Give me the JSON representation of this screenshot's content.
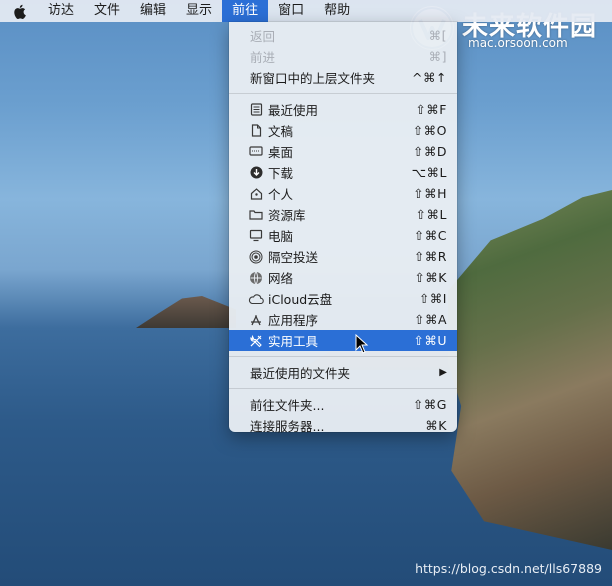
{
  "menubar": {
    "apple_icon": "apple-icon",
    "items": [
      {
        "label": "访达"
      },
      {
        "label": "文件"
      },
      {
        "label": "编辑"
      },
      {
        "label": "显示"
      },
      {
        "label": "前往"
      },
      {
        "label": "窗口"
      },
      {
        "label": "帮助"
      }
    ]
  },
  "brand": {
    "title": "未来软件园",
    "url": "mac.orsoon.com"
  },
  "dropdown": {
    "back": {
      "label": "返回",
      "shortcut": "⌘["
    },
    "forward": {
      "label": "前进",
      "shortcut": "⌘]"
    },
    "enclosing": {
      "label": "新窗口中的上层文件夹",
      "shortcut": "^⌘↑"
    },
    "places": [
      {
        "label": "最近使用",
        "shortcut": "⇧⌘F",
        "icon": "recents-icon"
      },
      {
        "label": "文稿",
        "shortcut": "⇧⌘O",
        "icon": "documents-icon"
      },
      {
        "label": "桌面",
        "shortcut": "⇧⌘D",
        "icon": "desktop-icon"
      },
      {
        "label": "下载",
        "shortcut": "⌥⌘L",
        "icon": "downloads-icon"
      },
      {
        "label": "个人",
        "shortcut": "⇧⌘H",
        "icon": "home-icon"
      },
      {
        "label": "资源库",
        "shortcut": "⇧⌘L",
        "icon": "library-icon"
      },
      {
        "label": "电脑",
        "shortcut": "⇧⌘C",
        "icon": "computer-icon"
      },
      {
        "label": "隔空投送",
        "shortcut": "⇧⌘R",
        "icon": "airdrop-icon"
      },
      {
        "label": "网络",
        "shortcut": "⇧⌘K",
        "icon": "network-icon"
      },
      {
        "label": "iCloud云盘",
        "shortcut": "⇧⌘I",
        "icon": "icloud-icon"
      },
      {
        "label": "应用程序",
        "shortcut": "⇧⌘A",
        "icon": "applications-icon"
      },
      {
        "label": "实用工具",
        "shortcut": "⇧⌘U",
        "icon": "utilities-icon"
      }
    ],
    "recent_folders": {
      "label": "最近使用的文件夹"
    },
    "go_to_folder": {
      "label": "前往文件夹...",
      "shortcut": "⇧⌘G"
    },
    "connect_server": {
      "label": "连接服务器...",
      "shortcut": "⌘K"
    }
  },
  "watermark": "https://blog.csdn.net/lls67889",
  "colors": {
    "highlight": "#2b6fd6",
    "disabled_text": "#a9aeb6"
  }
}
